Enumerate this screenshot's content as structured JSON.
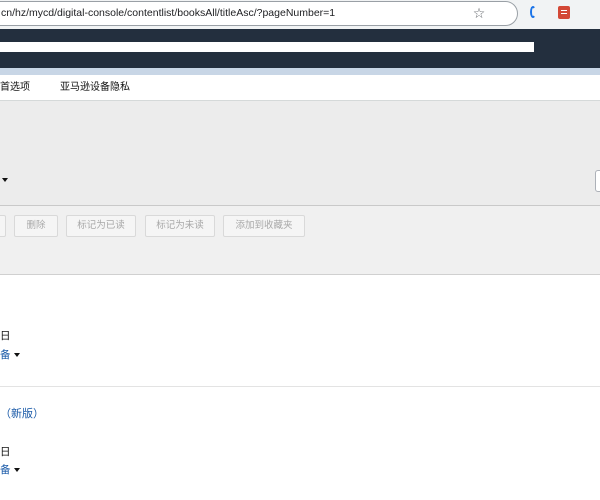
{
  "browser": {
    "url": "cn/hz/mycd/digital-console/contentlist/booksAll/titleAsc/?pageNumber=1",
    "bookmark_icon": "star-icon",
    "extensions": [
      "extension-icon",
      "extension-icon"
    ]
  },
  "tabs": [
    {
      "label": "首选项"
    },
    {
      "label": "亚马逊设备隐私"
    }
  ],
  "actions": {
    "delete_label": "删除",
    "mark_read_label": "标记为已读",
    "mark_unread_label": "标记为未读",
    "add_collection_label": "添加到收藏夹"
  },
  "items": [
    {
      "title": "",
      "date_fragment": "日",
      "device_fragment": "备"
    },
    {
      "title": "（新版）",
      "date_fragment": "日",
      "device_fragment": "备"
    }
  ],
  "colors": {
    "header_dark": "#232f3e",
    "link_blue": "#1a5aa8",
    "panel_gray": "#ececec"
  }
}
